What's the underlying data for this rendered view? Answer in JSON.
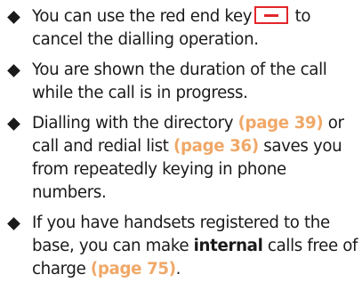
{
  "items": [
    {
      "before": "You can use the red end key",
      "icon": "end-key-icon",
      "after": " to cancel the dialling operation."
    },
    {
      "text": "You are shown the duration of the call while the call is in progress."
    },
    {
      "part1": "Dialling with the directory ",
      "ref1": "(page 39)",
      "part2": " or call and redial list ",
      "ref2": "(page 36)",
      "part3": " saves you from repeatedly keying in phone numbers."
    },
    {
      "part1": "If you have handsets registered to the base, you can make ",
      "emph": "internal",
      "part2": " calls free of charge ",
      "ref": "(page 75)",
      "part3": "."
    }
  ],
  "colors": {
    "text": "#1a1a1a",
    "page_ref": "#f0a868",
    "end_key": "#e3262b"
  }
}
